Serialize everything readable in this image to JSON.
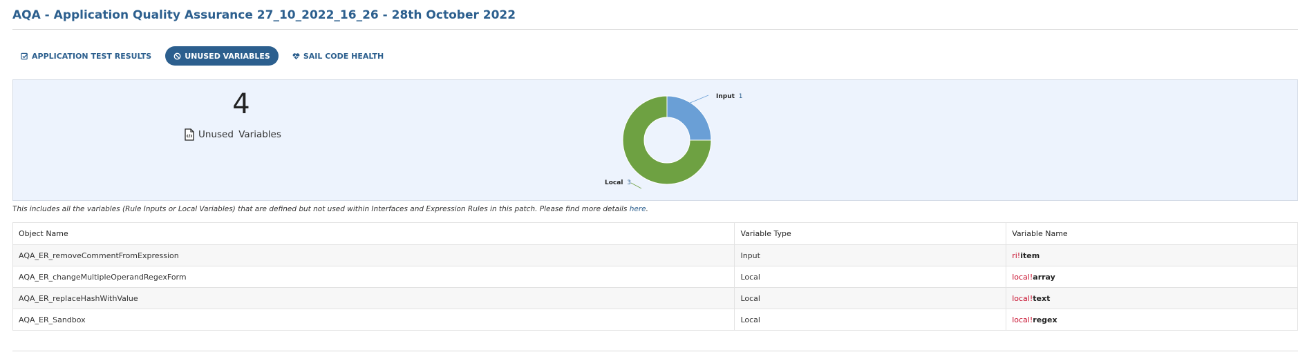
{
  "page": {
    "title": "AQA - Application Quality Assurance 27_10_2022_16_26 - 28th October 2022"
  },
  "tabs": [
    {
      "label": "APPLICATION TEST RESULTS",
      "icon": "check-square-icon",
      "active": false
    },
    {
      "label": "UNUSED VARIABLES",
      "icon": "ban-icon",
      "active": true
    },
    {
      "label": "SAIL CODE HEALTH",
      "icon": "heartbeat-icon",
      "active": false
    }
  ],
  "summary": {
    "count": "4",
    "label": "Unused Variables",
    "icon": "file-code-icon"
  },
  "chart_data": {
    "type": "pie",
    "donut": true,
    "categories": [
      "Input",
      "Local"
    ],
    "values": [
      1,
      3
    ],
    "colors": [
      "#6a9fd6",
      "#6ea142"
    ],
    "labels": [
      {
        "name": "Input",
        "value": "1"
      },
      {
        "name": "Local",
        "value": "3"
      }
    ]
  },
  "description": {
    "text": "This includes all the variables (Rule Inputs or Local Variables) that are defined but not used within Interfaces and Expression Rules in this patch. Please find more details ",
    "link_text": "here",
    "suffix": "."
  },
  "table": {
    "columns": [
      "Object Name",
      "Variable Type",
      "Variable Name"
    ],
    "rows": [
      {
        "object": "AQA_ER_removeCommentFromExpression",
        "type": "Input",
        "prefix": "ri!",
        "name": "item"
      },
      {
        "object": "AQA_ER_changeMultipleOperandRegexForm",
        "type": "Local",
        "prefix": "local!",
        "name": "array"
      },
      {
        "object": "AQA_ER_replaceHashWithValue",
        "type": "Local",
        "prefix": "local!",
        "name": "text"
      },
      {
        "object": "AQA_ER_Sandbox",
        "type": "Local",
        "prefix": "local!",
        "name": "regex"
      }
    ]
  }
}
